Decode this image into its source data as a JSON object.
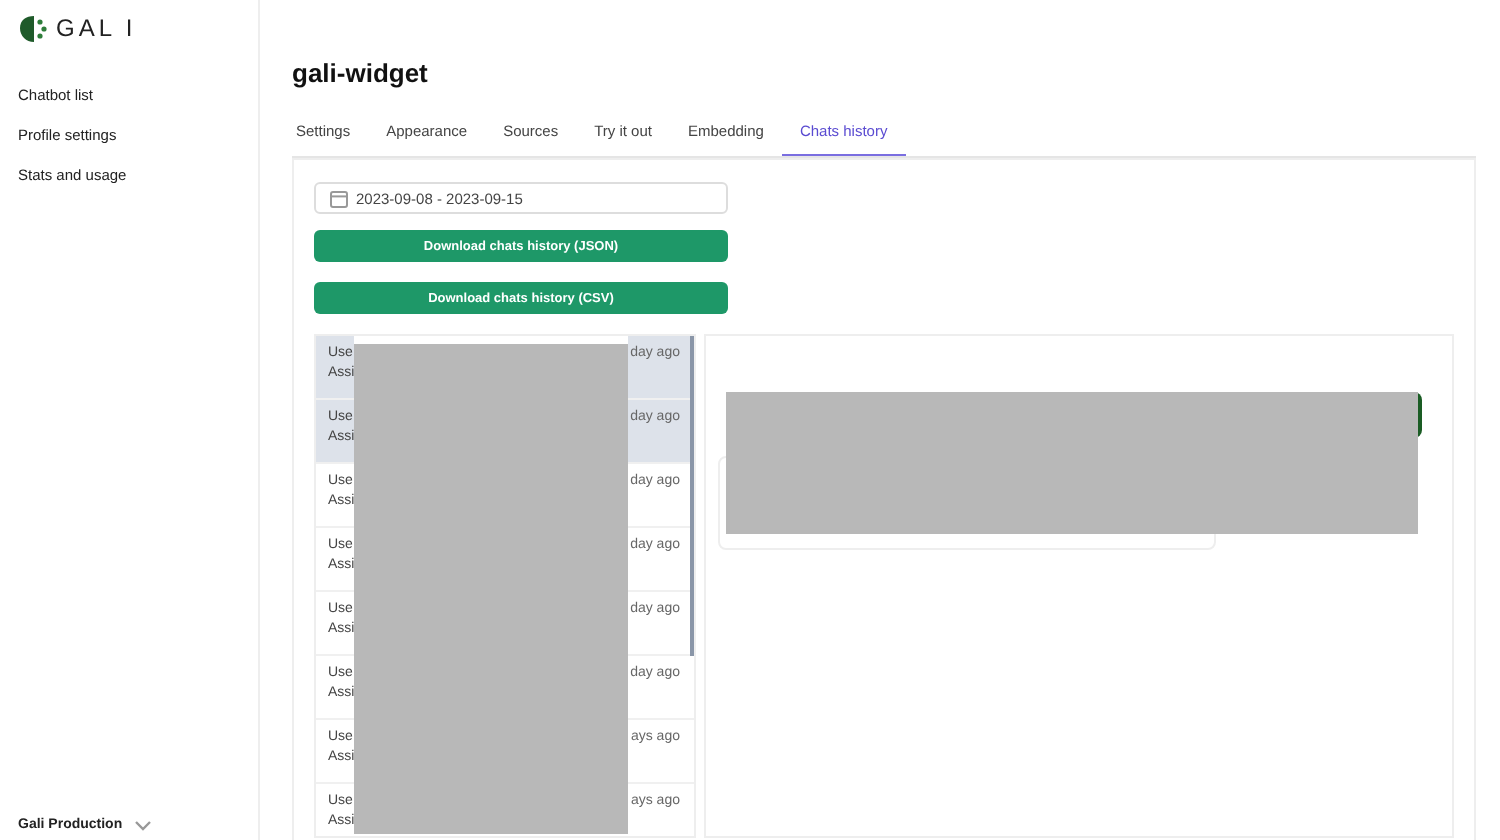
{
  "sidebar": {
    "logo": "GAL I",
    "items": [
      {
        "label": "Chatbot list"
      },
      {
        "label": "Profile settings"
      },
      {
        "label": "Stats and usage"
      }
    ],
    "workspace": "Gali Production"
  },
  "page": {
    "title": "gali-widget"
  },
  "tabs": [
    {
      "label": "Settings",
      "selected": false
    },
    {
      "label": "Appearance",
      "selected": false
    },
    {
      "label": "Sources",
      "selected": false
    },
    {
      "label": "Try it out",
      "selected": false
    },
    {
      "label": "Embedding",
      "selected": false
    },
    {
      "label": "Chats history",
      "selected": true
    }
  ],
  "date_range": {
    "value": "2023-09-08 - 2023-09-15"
  },
  "buttons": [
    "Download chats history (JSON)",
    "Download chats history (CSV)"
  ],
  "chats": [
    {
      "user": "Use",
      "assistant": "Assi",
      "time": "day ago",
      "highlighted": true
    },
    {
      "user": "Use",
      "assistant": "Assi",
      "time": "day ago",
      "highlighted": true
    },
    {
      "user": "Use",
      "assistant": "Assi",
      "time": "day ago",
      "highlighted": false
    },
    {
      "user": "Use",
      "assistant": "Assi",
      "time": "day ago",
      "highlighted": false
    },
    {
      "user": "Use",
      "assistant": "Assi",
      "time": "day ago",
      "highlighted": false
    },
    {
      "user": "Use",
      "assistant": "Assi",
      "time": "day ago",
      "highlighted": false
    },
    {
      "user": "Use",
      "assistant": "Assi",
      "time": "ays ago",
      "highlighted": false
    },
    {
      "user": "Use",
      "assistant": "Assi",
      "time": "ays ago",
      "highlighted": false
    }
  ]
}
